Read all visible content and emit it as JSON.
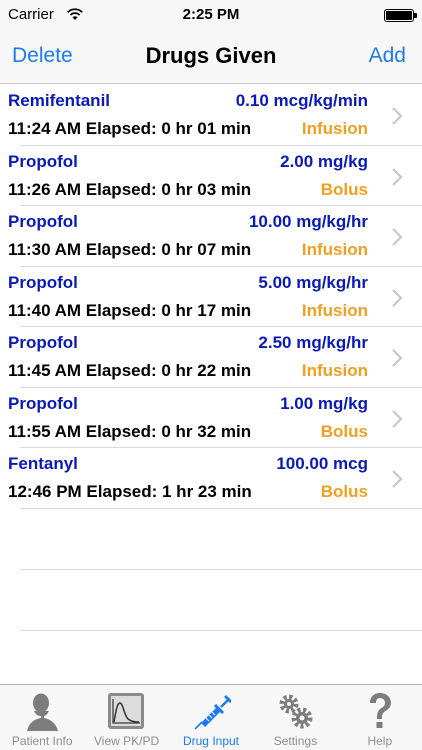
{
  "status": {
    "carrier": "Carrier",
    "time": "2:25 PM"
  },
  "nav": {
    "left_label": "Delete",
    "title": "Drugs Given",
    "right_label": "Add"
  },
  "doses": [
    {
      "drug": "Remifentanil",
      "dose": "0.10 mcg/kg/min",
      "time": "11:24 AM Elapsed: 0 hr 01 min",
      "type": "Infusion"
    },
    {
      "drug": "Propofol",
      "dose": "2.00 mg/kg",
      "time": "11:26 AM Elapsed: 0 hr 03 min",
      "type": "Bolus"
    },
    {
      "drug": "Propofol",
      "dose": "10.00 mg/kg/hr",
      "time": "11:30 AM Elapsed: 0 hr 07 min",
      "type": "Infusion"
    },
    {
      "drug": "Propofol",
      "dose": "5.00 mg/kg/hr",
      "time": "11:40 AM Elapsed: 0 hr 17 min",
      "type": "Infusion"
    },
    {
      "drug": "Propofol",
      "dose": "2.50 mg/kg/hr",
      "time": "11:45 AM Elapsed: 0 hr 22 min",
      "type": "Infusion"
    },
    {
      "drug": "Propofol",
      "dose": "1.00 mg/kg",
      "time": "11:55 AM Elapsed: 0 hr 32 min",
      "type": "Bolus"
    },
    {
      "drug": "Fentanyl",
      "dose": "100.00 mcg",
      "time": "12:46 PM Elapsed: 1 hr 23 min",
      "type": "Bolus"
    }
  ],
  "tabs": [
    {
      "label": "Patient Info",
      "icon": "person-icon"
    },
    {
      "label": "View PK/PD",
      "icon": "graph-icon"
    },
    {
      "label": "Drug Input",
      "icon": "syringe-icon"
    },
    {
      "label": "Settings",
      "icon": "gears-icon"
    },
    {
      "label": "Help",
      "icon": "question-icon"
    }
  ],
  "active_tab": "Drug Input",
  "colors": {
    "accent": "#1d7bf0",
    "drug_text": "#0a1ab8",
    "type_text": "#f0a020"
  }
}
